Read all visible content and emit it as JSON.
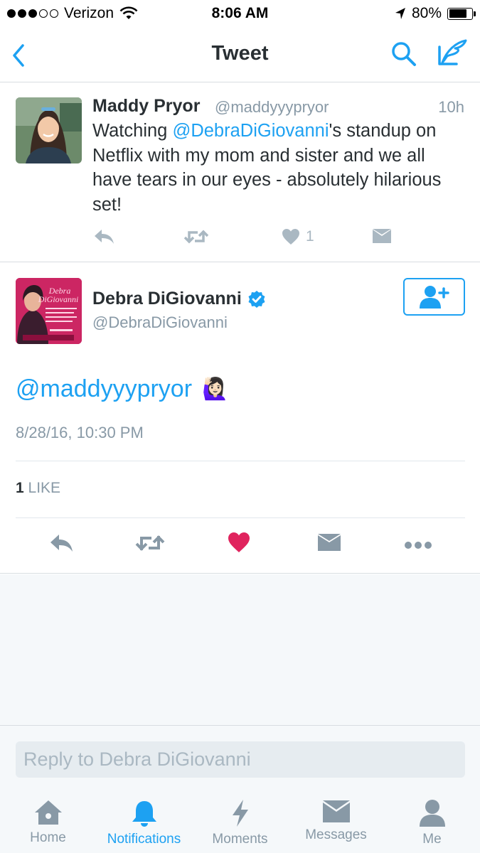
{
  "status_bar": {
    "carrier": "Verizon",
    "time": "8:06 AM",
    "battery": "80%",
    "battery_level": 0.8,
    "signal_bars_filled": 3,
    "signal_bars_total": 5
  },
  "nav": {
    "title": "Tweet",
    "icons": [
      "back-chevron-icon",
      "search-icon",
      "compose-icon"
    ]
  },
  "tweet_parent": {
    "author_name": "Maddy Pryor",
    "author_handle": "@maddyyypryor",
    "time_ago": "10h",
    "text_before": "Watching ",
    "text_mention": "@DebraDiGiovanni",
    "text_after": "'s standup on Netflix with my mom and sister and we all have tears in our eyes - absolutely hilarious set!",
    "like_count": "1"
  },
  "tweet_main": {
    "author_name": "Debra DiGiovanni",
    "author_handle": "@DebraDiGiovanni",
    "verified": true,
    "avatar_text": "Debra DiGiovanni",
    "text_mention": "@maddyyypryor",
    "emoji": "🙋🏻‍♀️",
    "date": "8/28/16, 10:30 PM",
    "likes_count": "1",
    "likes_label": "LIKE",
    "liked": true
  },
  "reply": {
    "placeholder": "Reply to Debra DiGiovanni"
  },
  "tabs": [
    {
      "label": "Home",
      "icon": "home-icon",
      "active": false
    },
    {
      "label": "Notifications",
      "icon": "bell-icon",
      "active": true
    },
    {
      "label": "Moments",
      "icon": "lightning-icon",
      "active": false
    },
    {
      "label": "Messages",
      "icon": "envelope-icon",
      "active": false
    },
    {
      "label": "Me",
      "icon": "person-icon",
      "active": false
    }
  ],
  "colors": {
    "accent": "#1da1f2",
    "like_red": "#e0245e",
    "muted_gray": "#8899a6",
    "icon_gray": "#aab8c2"
  }
}
